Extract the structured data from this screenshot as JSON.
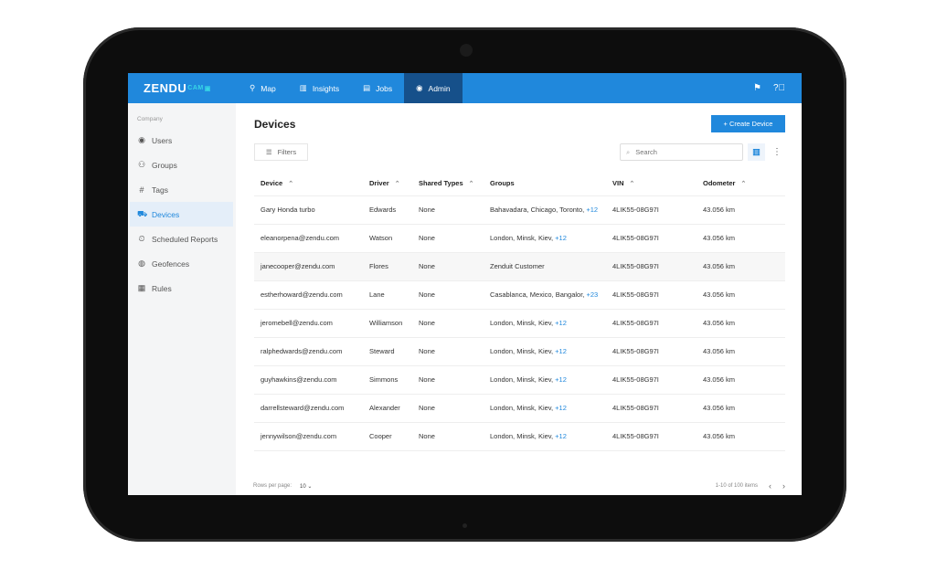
{
  "app": {
    "logo": "ZENDU",
    "logo_sub": "CAM"
  },
  "nav": [
    {
      "label": "Map",
      "icon": "map-pin-icon"
    },
    {
      "label": "Insights",
      "icon": "chart-icon"
    },
    {
      "label": "Jobs",
      "icon": "document-icon"
    },
    {
      "label": "Admin",
      "icon": "user-circle-icon",
      "active": true
    }
  ],
  "header_icons": [
    "flag-icon",
    "help-icon"
  ],
  "sidebar": {
    "caption": "Company",
    "items": [
      {
        "label": "Users",
        "icon": "user-circle-icon"
      },
      {
        "label": "Groups",
        "icon": "groups-icon"
      },
      {
        "label": "Tags",
        "icon": "hash-icon"
      },
      {
        "label": "Devices",
        "icon": "car-icon",
        "active": true
      },
      {
        "label": "Scheduled Reports",
        "icon": "scheduled-report-icon"
      },
      {
        "label": "Geofences",
        "icon": "globe-icon"
      },
      {
        "label": "Rules",
        "icon": "table-icon"
      }
    ]
  },
  "main": {
    "title": "Devices",
    "create_label": "+ Create Device",
    "filters_label": "Filters",
    "search_placeholder": "Search"
  },
  "table": {
    "columns": [
      "Device",
      "Driver",
      "Shared Types",
      "Groups",
      "VIN",
      "Odometer"
    ],
    "rows": [
      {
        "device": "Gary Honda turbo",
        "driver": "Edwards",
        "shared": "None",
        "groups": "Bahavadara, Chicago, Toronto,",
        "more": "+12",
        "vin": "4LIK55-08G97I",
        "odo": "43.056 km"
      },
      {
        "device": "eleanorpena@zendu.com",
        "driver": "Watson",
        "shared": "None",
        "groups": "London, Minsk, Kiev,",
        "more": "+12",
        "vin": "4LIK55-08G97I",
        "odo": "43.056 km"
      },
      {
        "device": "janecooper@zendu.com",
        "driver": "Flores",
        "shared": "None",
        "groups": "Zenduit Customer",
        "more": "",
        "vin": "4LIK55-08G97I",
        "odo": "43.056 km"
      },
      {
        "device": "estherhoward@zendu.com",
        "driver": "Lane",
        "shared": "None",
        "groups": "Casablanca, Mexico, Bangalor,",
        "more": "+23",
        "vin": "4LIK55-08G97I",
        "odo": "43.056 km"
      },
      {
        "device": "jeromebell@zendu.com",
        "driver": "Williamson",
        "shared": "None",
        "groups": "London, Minsk, Kiev,",
        "more": "+12",
        "vin": "4LIK55-08G97I",
        "odo": "43.056 km"
      },
      {
        "device": "ralphedwards@zendu.com",
        "driver": "Steward",
        "shared": "None",
        "groups": "London, Minsk, Kiev,",
        "more": "+12",
        "vin": "4LIK55-08G97I",
        "odo": "43.056 km"
      },
      {
        "device": "guyhawkins@zendu.com",
        "driver": "Simmons",
        "shared": "None",
        "groups": "London, Minsk, Kiev,",
        "more": "+12",
        "vin": "4LIK55-08G97I",
        "odo": "43.056 km"
      },
      {
        "device": "darrellsteward@zendu.com",
        "driver": "Alexander",
        "shared": "None",
        "groups": "London, Minsk, Kiev,",
        "more": "+12",
        "vin": "4LIK55-08G97I",
        "odo": "43.056 km"
      },
      {
        "device": "jennywilson@zendu.com",
        "driver": "Cooper",
        "shared": "None",
        "groups": "London, Minsk, Kiev,",
        "more": "+12",
        "vin": "4LIK55-08G97I",
        "odo": "43.056 km"
      }
    ]
  },
  "footer": {
    "rows_label": "Rows per page:",
    "rows_value": "10",
    "range": "1-10 of 100 items"
  },
  "colors": {
    "primary": "#2088dc",
    "nav_active": "#16508a",
    "sidebar_bg": "#f4f5f6"
  }
}
